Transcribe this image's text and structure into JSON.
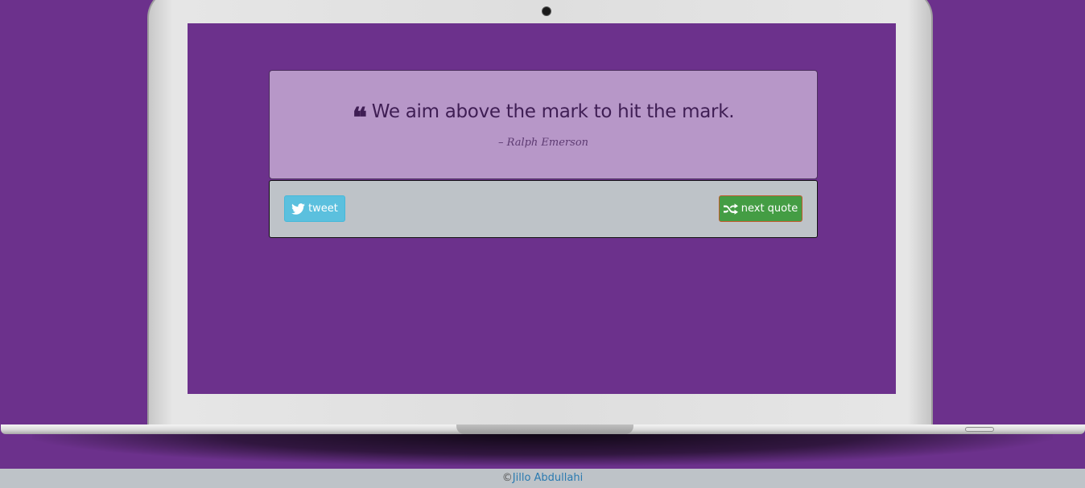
{
  "quote": {
    "text": "We aim above the mark to hit the mark.",
    "author": "– Ralph Emerson",
    "icon": "quote-left-icon"
  },
  "actions": {
    "tweet_label": "tweet",
    "tweet_icon": "twitter-icon",
    "next_label": "next quote",
    "next_icon": "shuffle-icon"
  },
  "footer": {
    "copyright_symbol": "©",
    "author_link": "Jillo Abdullahi"
  },
  "colors": {
    "background": "#6c318c",
    "quote_box": "#b797c8",
    "action_box": "#bec3c8",
    "tweet_button": "#5bc0de",
    "next_button": "#449d44"
  }
}
